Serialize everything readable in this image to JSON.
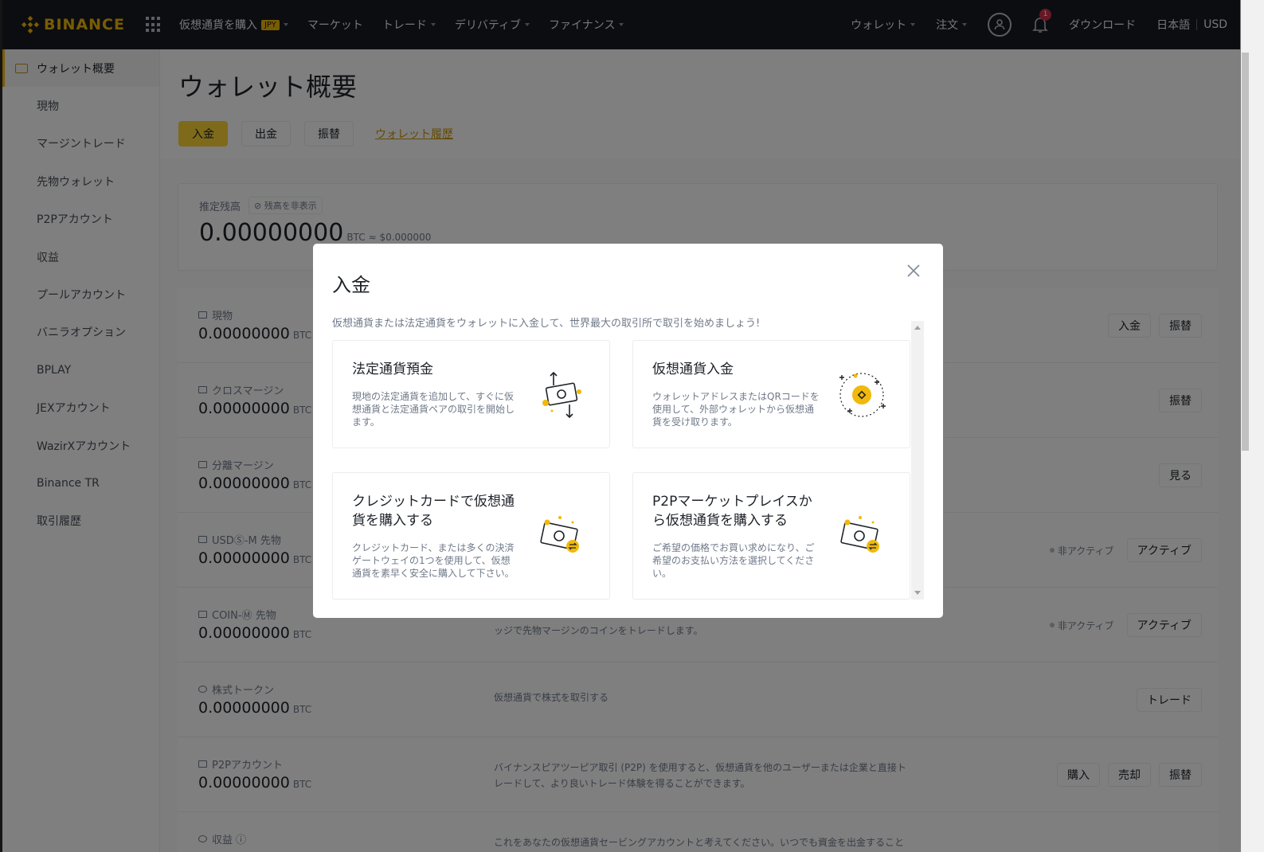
{
  "colors": {
    "brand": "#f0b90b",
    "nav_bg": "#181a20",
    "primary_btn": "#fcd535",
    "badge_red": "#cf304a"
  },
  "nav": {
    "logo": "BINANCE",
    "items": [
      {
        "label": "仮想通貨を購入",
        "badge": "JPY"
      },
      {
        "label": "マーケット"
      },
      {
        "label": "トレード"
      },
      {
        "label": "デリバティブ"
      },
      {
        "label": "ファイナンス"
      }
    ],
    "right": {
      "wallet": "ウォレット",
      "orders": "注文",
      "notif_count": "1",
      "download": "ダウンロード",
      "language": "日本語",
      "currency": "USD"
    }
  },
  "sidebar": {
    "items": [
      {
        "label": "ウォレット概要"
      },
      {
        "label": "現物"
      },
      {
        "label": "マージントレード"
      },
      {
        "label": "先物ウォレット"
      },
      {
        "label": "P2Pアカウント"
      },
      {
        "label": "収益"
      },
      {
        "label": "プールアカウント"
      },
      {
        "label": "バニラオプション"
      },
      {
        "label": "BPLAY"
      },
      {
        "label": "JEXアカウント"
      },
      {
        "label": "WazirXアカウント"
      },
      {
        "label": "Binance TR"
      },
      {
        "label": "取引履歴"
      }
    ]
  },
  "main": {
    "title": "ウォレット概要",
    "actions": {
      "deposit": "入金",
      "withdraw": "出金",
      "transfer": "振替",
      "history": "ウォレット履歴"
    },
    "balance": {
      "label": "推定残高",
      "hide": "残高を非表示",
      "value": "0.00000000",
      "unit": "BTC",
      "fiat": "≈ $0.000000"
    },
    "accounts": [
      {
        "name": "現物",
        "value": "0.00000000",
        "unit": "BTC",
        "desc": "",
        "buttons": [
          "入金",
          "振替"
        ],
        "status": ""
      },
      {
        "name": "クロスマージン",
        "value": "0.00000000",
        "unit": "BTC",
        "desc": "",
        "buttons": [
          "振替"
        ],
        "status": ""
      },
      {
        "name": "分離マージン",
        "value": "0.00000000",
        "unit": "BTC",
        "desc": "",
        "buttons": [
          "見る"
        ],
        "status": ""
      },
      {
        "name": "USDⓈ-M 先物",
        "value": "0.00000000",
        "unit": "BTC",
        "desc": "",
        "buttons": [
          "アクティブ"
        ],
        "status": "非アクティブ"
      },
      {
        "name": "COIN-Ⓜ 先物",
        "value": "0.00000000",
        "unit": "BTC",
        "desc": "ッジで先物マージンのコインをトレードします。",
        "buttons": [
          "アクティブ"
        ],
        "status": "非アクティブ"
      },
      {
        "name": "株式トークン",
        "value": "0.00000000",
        "unit": "BTC",
        "desc": "仮想通貨で株式を取引する",
        "buttons": [
          "トレード"
        ],
        "status": ""
      },
      {
        "name": "P2Pアカウント",
        "value": "0.00000000",
        "unit": "BTC",
        "desc": "バイナンスピアツーピア取引 (P2P) を使用すると、仮想通貨を他のユーザーまたは企業と直接トレードして、より良いトレード体験を得ることができます。",
        "buttons": [
          "購入",
          "売却",
          "振替"
        ],
        "status": ""
      },
      {
        "name": "収益",
        "value": "",
        "unit": "",
        "desc": "これをあなたの仮想通貨セービングアカウントと考えてください。いつでも資金を出金すること",
        "buttons": [],
        "status": ""
      }
    ]
  },
  "modal": {
    "title": "入金",
    "subtitle": "仮想通貨または法定通貨をウォレットに入金して、世界最大の取引所で取引を始めましょう!",
    "options": [
      {
        "title": "法定通貨預金",
        "desc": "現地の法定通貨を追加して、すぐに仮想通貨と法定通貨ペアの取引を開始します。",
        "icon": "fiat-exchange-icon"
      },
      {
        "title": "仮想通貨入金",
        "desc": "ウォレットアドレスまたはQRコードを使用して、外部ウォレットから仮想通貨を受け取ります。",
        "icon": "crypto-deposit-icon"
      },
      {
        "title": "クレジットカードで仮想通貨を購入する",
        "desc": "クレジットカード、または多くの決済ゲートウェイの1つを使用して、仮想通貨を素早く安全に購入して下さい。",
        "icon": "card-buy-icon"
      },
      {
        "title": "P2Pマーケットプレイスから仮想通貨を購入する",
        "desc": "ご希望の価格でお買い求めになり、ご希望のお支払い方法を選択してください。",
        "icon": "p2p-buy-icon"
      }
    ]
  }
}
